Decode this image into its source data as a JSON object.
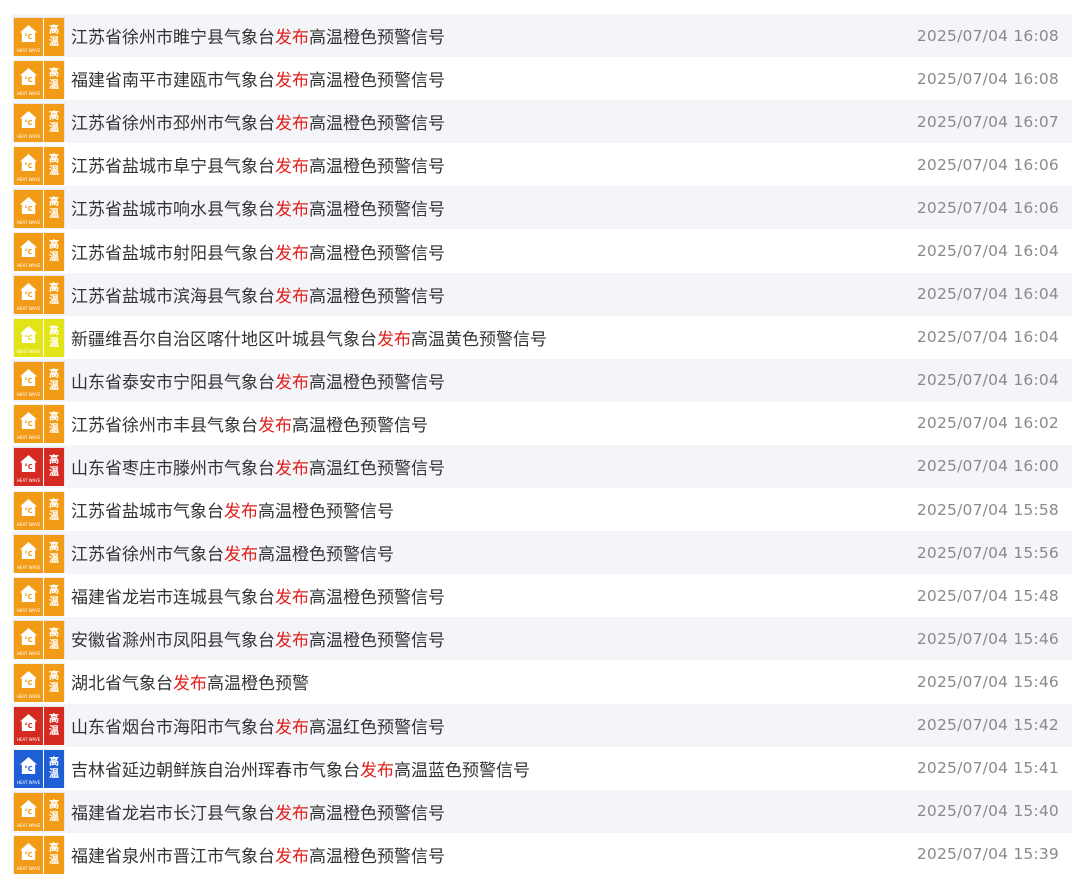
{
  "colors": {
    "orange": "#f29b16",
    "yellow": "#e3e417",
    "red": "#d42a22",
    "blue": "#1f5fd6",
    "highlight": "#e0201c"
  },
  "icon": {
    "glyph_top": "高",
    "glyph_bottom": "温",
    "footer": "HEAT WAVE",
    "house_symbol": "°C",
    "semantic": "heat-wave-warning-icon"
  },
  "alerts": [
    {
      "prefix": "江苏省徐州市睢宁县气象台",
      "verb": "发布",
      "suffix": "高温橙色预警信号",
      "level": "orange",
      "time": "2025/07/04 16:08"
    },
    {
      "prefix": "福建省南平市建瓯市气象台",
      "verb": "发布",
      "suffix": "高温橙色预警信号",
      "level": "orange",
      "time": "2025/07/04 16:08"
    },
    {
      "prefix": "江苏省徐州市邳州市气象台",
      "verb": "发布",
      "suffix": "高温橙色预警信号",
      "level": "orange",
      "time": "2025/07/04 16:07"
    },
    {
      "prefix": "江苏省盐城市阜宁县气象台",
      "verb": "发布",
      "suffix": "高温橙色预警信号",
      "level": "orange",
      "time": "2025/07/04 16:06"
    },
    {
      "prefix": "江苏省盐城市响水县气象台",
      "verb": "发布",
      "suffix": "高温橙色预警信号",
      "level": "orange",
      "time": "2025/07/04 16:06"
    },
    {
      "prefix": "江苏省盐城市射阳县气象台",
      "verb": "发布",
      "suffix": "高温橙色预警信号",
      "level": "orange",
      "time": "2025/07/04 16:04"
    },
    {
      "prefix": "江苏省盐城市滨海县气象台",
      "verb": "发布",
      "suffix": "高温橙色预警信号",
      "level": "orange",
      "time": "2025/07/04 16:04"
    },
    {
      "prefix": "新疆维吾尔自治区喀什地区叶城县气象台",
      "verb": "发布",
      "suffix": "高温黄色预警信号",
      "level": "yellow",
      "time": "2025/07/04 16:04"
    },
    {
      "prefix": "山东省泰安市宁阳县气象台",
      "verb": "发布",
      "suffix": "高温橙色预警信号",
      "level": "orange",
      "time": "2025/07/04 16:04"
    },
    {
      "prefix": "江苏省徐州市丰县气象台",
      "verb": "发布",
      "suffix": "高温橙色预警信号",
      "level": "orange",
      "time": "2025/07/04 16:02"
    },
    {
      "prefix": "山东省枣庄市滕州市气象台",
      "verb": "发布",
      "suffix": "高温红色预警信号",
      "level": "red",
      "time": "2025/07/04 16:00"
    },
    {
      "prefix": "江苏省盐城市气象台",
      "verb": "发布",
      "suffix": "高温橙色预警信号",
      "level": "orange",
      "time": "2025/07/04 15:58"
    },
    {
      "prefix": "江苏省徐州市气象台",
      "verb": "发布",
      "suffix": "高温橙色预警信号",
      "level": "orange",
      "time": "2025/07/04 15:56"
    },
    {
      "prefix": "福建省龙岩市连城县气象台",
      "verb": "发布",
      "suffix": "高温橙色预警信号",
      "level": "orange",
      "time": "2025/07/04 15:48"
    },
    {
      "prefix": "安徽省滁州市凤阳县气象台",
      "verb": "发布",
      "suffix": "高温橙色预警信号",
      "level": "orange",
      "time": "2025/07/04 15:46"
    },
    {
      "prefix": "湖北省气象台",
      "verb": "发布",
      "suffix": "高温橙色预警",
      "level": "orange",
      "time": "2025/07/04 15:46"
    },
    {
      "prefix": "山东省烟台市海阳市气象台",
      "verb": "发布",
      "suffix": "高温红色预警信号",
      "level": "red",
      "time": "2025/07/04 15:42"
    },
    {
      "prefix": "吉林省延边朝鲜族自治州珲春市气象台",
      "verb": "发布",
      "suffix": "高温蓝色预警信号",
      "level": "blue",
      "time": "2025/07/04 15:41"
    },
    {
      "prefix": "福建省龙岩市长汀县气象台",
      "verb": "发布",
      "suffix": "高温橙色预警信号",
      "level": "orange",
      "time": "2025/07/04 15:40"
    },
    {
      "prefix": "福建省泉州市晋江市气象台",
      "verb": "发布",
      "suffix": "高温橙色预警信号",
      "level": "orange",
      "time": "2025/07/04 15:39"
    }
  ]
}
